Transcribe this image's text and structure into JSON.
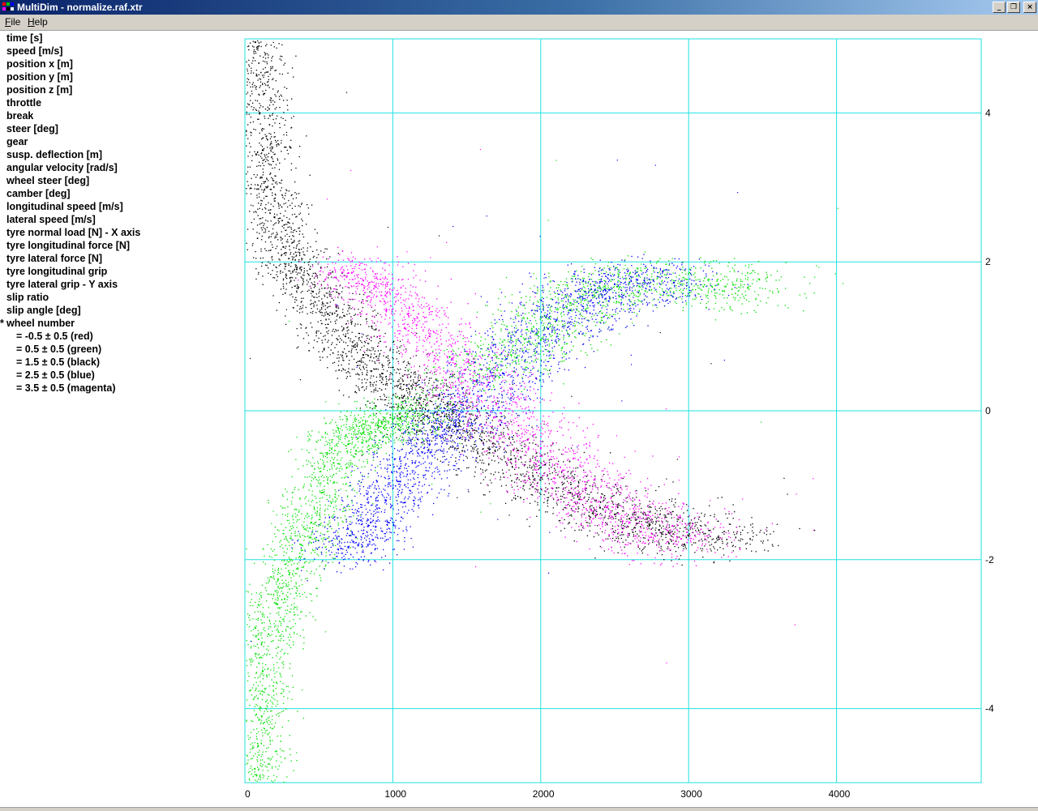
{
  "window": {
    "title": "MultiDim - normalize.raf.xtr"
  },
  "window_controls": {
    "minimize": "_",
    "restore": "❐",
    "close": "×"
  },
  "menu": {
    "file": "File",
    "file_key": "F",
    "file_rest": "ile",
    "help": "Help",
    "help_key": "H",
    "help_rest": "elp"
  },
  "variables": [
    {
      "label": "time [s]",
      "marker": ""
    },
    {
      "label": "speed [m/s]",
      "marker": ""
    },
    {
      "label": "position x [m]",
      "marker": ""
    },
    {
      "label": "position y [m]",
      "marker": ""
    },
    {
      "label": "position z [m]",
      "marker": ""
    },
    {
      "label": "throttle",
      "marker": ""
    },
    {
      "label": "break",
      "marker": ""
    },
    {
      "label": "steer [deg]",
      "marker": ""
    },
    {
      "label": "gear",
      "marker": ""
    },
    {
      "label": "susp. deflection [m]",
      "marker": ""
    },
    {
      "label": "angular velocity [rad/s]",
      "marker": ""
    },
    {
      "label": "wheel steer [deg]",
      "marker": ""
    },
    {
      "label": "camber [deg]",
      "marker": ""
    },
    {
      "label": "longitudinal speed [m/s]",
      "marker": ""
    },
    {
      "label": "lateral speed [m/s]",
      "marker": ""
    },
    {
      "label": "tyre normal load [N] - X axis",
      "marker": ""
    },
    {
      "label": "tyre longitudinal force [N]",
      "marker": ""
    },
    {
      "label": "tyre lateral force [N]",
      "marker": ""
    },
    {
      "label": "tyre longitudinal grip",
      "marker": ""
    },
    {
      "label": "tyre lateral grip - Y axis",
      "marker": ""
    },
    {
      "label": "slip ratio",
      "marker": ""
    },
    {
      "label": "slip angle [deg]",
      "marker": ""
    },
    {
      "label": "wheel number",
      "marker": "*"
    }
  ],
  "wheel_classes": [
    {
      "label": "= -0.5 ± 0.5 (red)"
    },
    {
      "label": "= 0.5 ± 0.5 (green)"
    },
    {
      "label": "= 1.5 ± 0.5 (black)"
    },
    {
      "label": "= 2.5 ± 0.5 (blue)"
    },
    {
      "label": "= 3.5 ± 0.5 (magenta)"
    }
  ],
  "chart_data": {
    "type": "scatter",
    "title": "",
    "xlabel": "",
    "ylabel": "",
    "xlim": [
      0,
      5000
    ],
    "ylim": [
      -5,
      5
    ],
    "x_ticks": [
      0,
      1000,
      2000,
      3000,
      4000
    ],
    "y_ticks": [
      4,
      2,
      0,
      -2,
      -4
    ],
    "grid": true,
    "grid_color": "#22e0e0",
    "series": [
      {
        "name": "-0.5 ± 0.5 (red)",
        "color": "#ff0000",
        "points": []
      },
      {
        "name": "0.5 ± 0.5 (green)",
        "color": "#00e000",
        "points": [
          [
            80,
            -4.9
          ],
          [
            90,
            -4.5
          ],
          [
            100,
            -4.0
          ],
          [
            120,
            -3.5
          ],
          [
            160,
            -3.0
          ],
          [
            220,
            -2.6
          ],
          [
            300,
            -2.2
          ],
          [
            380,
            -1.8
          ],
          [
            450,
            -1.5
          ],
          [
            520,
            -1.1
          ],
          [
            600,
            -0.7
          ],
          [
            700,
            -0.45
          ],
          [
            800,
            -0.3
          ],
          [
            900,
            -0.2
          ],
          [
            1000,
            -0.12
          ],
          [
            1100,
            -0.08
          ],
          [
            1600,
            0.55
          ],
          [
            1800,
            0.75
          ],
          [
            2000,
            0.95
          ],
          [
            2100,
            1.2
          ],
          [
            2200,
            1.45
          ],
          [
            2400,
            1.65
          ],
          [
            2600,
            1.72
          ],
          [
            2900,
            1.72
          ],
          [
            3200,
            1.7
          ],
          [
            3400,
            1.65
          ]
        ]
      },
      {
        "name": "1.5 ± 0.5 (black)",
        "color": "#000000",
        "points": [
          [
            70,
            4.95
          ],
          [
            80,
            4.5
          ],
          [
            100,
            4.0
          ],
          [
            120,
            3.5
          ],
          [
            150,
            3.0
          ],
          [
            200,
            2.6
          ],
          [
            260,
            2.2
          ],
          [
            350,
            1.9
          ],
          [
            460,
            1.6
          ],
          [
            560,
            1.3
          ],
          [
            680,
            1.0
          ],
          [
            800,
            0.75
          ],
          [
            930,
            0.5
          ],
          [
            1050,
            0.3
          ],
          [
            1180,
            0.1
          ],
          [
            1300,
            -0.05
          ],
          [
            1450,
            -0.2
          ],
          [
            1600,
            -0.4
          ],
          [
            1800,
            -0.65
          ],
          [
            2000,
            -0.9
          ],
          [
            2200,
            -1.1
          ],
          [
            2400,
            -1.3
          ],
          [
            2600,
            -1.45
          ],
          [
            2800,
            -1.6
          ],
          [
            3000,
            -1.68
          ],
          [
            3200,
            -1.7
          ]
        ]
      },
      {
        "name": "2.5 ± 0.5 (blue)",
        "color": "#0000ff",
        "points": [
          [
            650,
            -1.85
          ],
          [
            750,
            -1.7
          ],
          [
            850,
            -1.5
          ],
          [
            950,
            -1.2
          ],
          [
            1050,
            -0.95
          ],
          [
            1150,
            -0.7
          ],
          [
            1250,
            -0.45
          ],
          [
            1350,
            -0.25
          ],
          [
            1450,
            -0.05
          ],
          [
            1600,
            0.2
          ],
          [
            1750,
            0.5
          ],
          [
            1900,
            0.8
          ],
          [
            2050,
            1.1
          ],
          [
            2200,
            1.35
          ],
          [
            2350,
            1.55
          ],
          [
            2500,
            1.7
          ],
          [
            2700,
            1.75
          ],
          [
            2900,
            1.72
          ]
        ]
      },
      {
        "name": "3.5 ± 0.5 (magenta)",
        "color": "#ff00ff",
        "points": [
          [
            700,
            1.85
          ],
          [
            800,
            1.75
          ],
          [
            950,
            1.55
          ],
          [
            1100,
            1.3
          ],
          [
            1250,
            1.0
          ],
          [
            1400,
            0.7
          ],
          [
            1550,
            0.4
          ],
          [
            1700,
            0.1
          ],
          [
            1850,
            -0.2
          ],
          [
            2000,
            -0.5
          ],
          [
            2150,
            -0.8
          ],
          [
            2300,
            -1.05
          ],
          [
            2450,
            -1.3
          ],
          [
            2600,
            -1.5
          ],
          [
            2750,
            -1.65
          ],
          [
            2950,
            -1.72
          ]
        ]
      }
    ]
  }
}
